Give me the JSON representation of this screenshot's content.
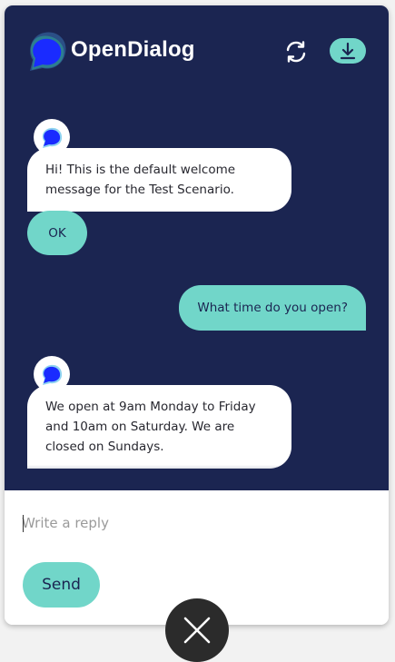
{
  "header": {
    "brand": "OpenDialog",
    "refresh_icon": "refresh-icon",
    "download_icon": "download-icon"
  },
  "messages": [
    {
      "from": "bot",
      "text": "Hi! This is the default welcome message for the Test Scenario."
    },
    {
      "from": "bot-button",
      "text": "OK"
    },
    {
      "from": "user",
      "text": "What time do you open?"
    },
    {
      "from": "bot",
      "text": "We open at 9am Monday to Friday and 10am on Saturday. We are closed on Sundays."
    }
  ],
  "composer": {
    "placeholder": "Write a reply",
    "send_label": "Send"
  },
  "colors": {
    "chat_background": "#1b2551",
    "accent": "#71d6c9",
    "bubble": "#ffffff",
    "close_button": "#2b2b2b"
  },
  "icons": {
    "avatar": "bot-avatar-icon",
    "close": "close-icon"
  }
}
